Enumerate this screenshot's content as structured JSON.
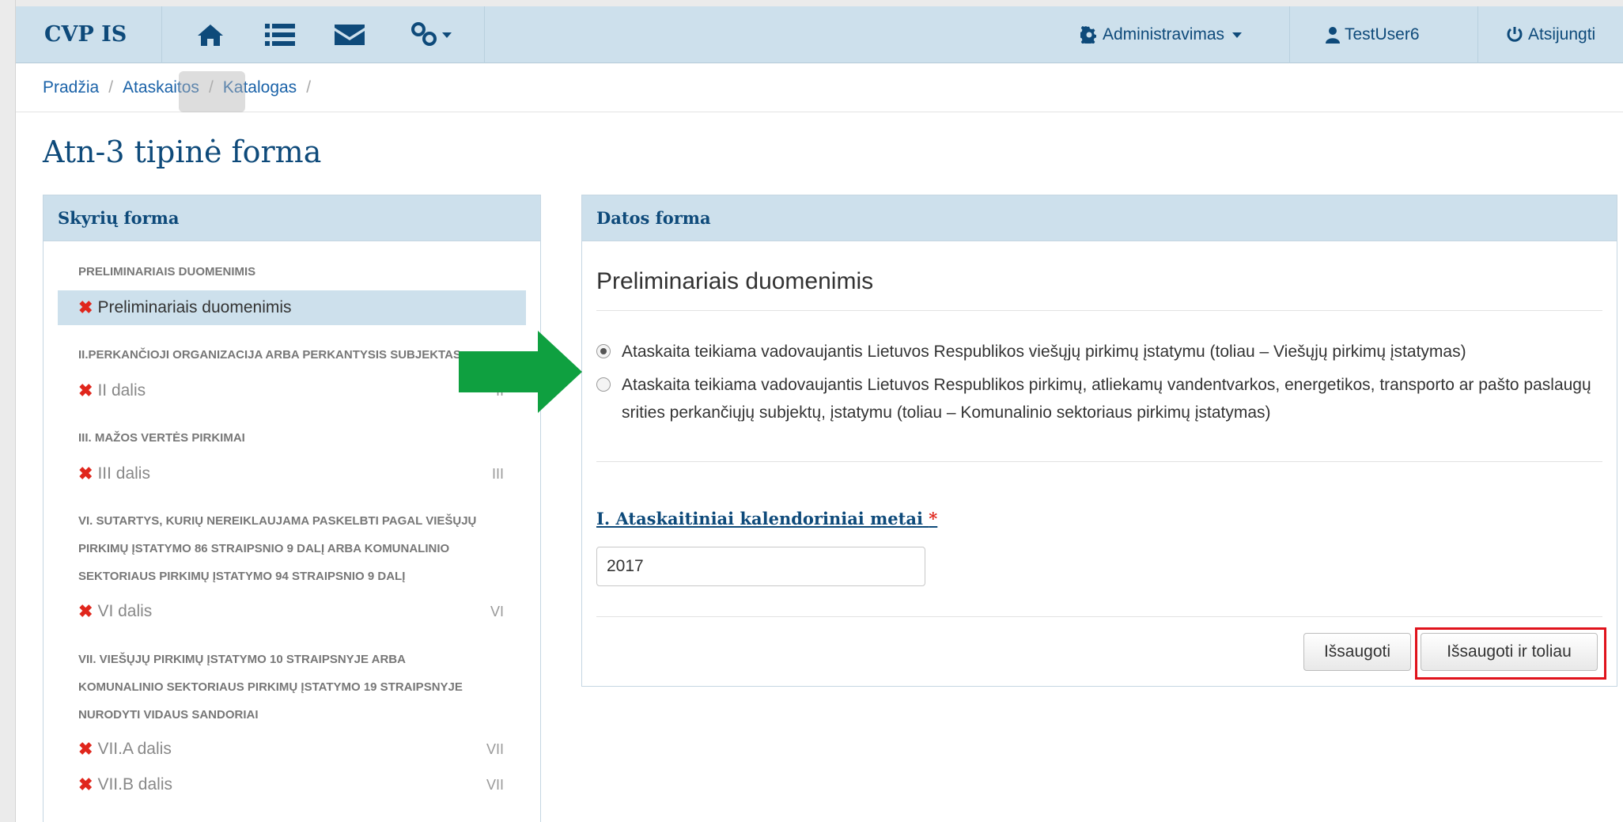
{
  "navbar": {
    "brand": "CVP IS",
    "icons": [
      "home-icon",
      "list-icon",
      "envelope-icon",
      "link-icon"
    ],
    "admin_label": "Administravimas",
    "user_label": "TestUser6",
    "logout_label": "Atsijungti"
  },
  "breadcrumb": {
    "items": [
      "Pradžia",
      "Ataskaitos",
      "Katalogas"
    ]
  },
  "page_title": "Atn-3 tipinė forma",
  "left_panel": {
    "title": "Skyrių forma",
    "sections": [
      {
        "header": "PRELIMINARIAIS DUOMENIMIS",
        "items": [
          {
            "label": "Preliminariais duomenimis",
            "roman": ""
          }
        ]
      },
      {
        "header": "II.PERKANČIOJI ORGANIZACIJA ARBA PERKANTYSIS SUBJEKTAS",
        "items": [
          {
            "label": "II dalis",
            "roman": "II"
          }
        ]
      },
      {
        "header": "III. MAŽOS VERTĖS PIRKIMAI",
        "items": [
          {
            "label": "III dalis",
            "roman": "III"
          }
        ]
      },
      {
        "header_lines": [
          "VI. SUTARTYS, KURIŲ NEREIKLAUJAMA PASKELBTI PAGAL VIEŠŲJŲ",
          "PIRKIMŲ ĮSTATYMO 86 STRAIPSNIO 9 DALĮ ARBA KOMUNALINIO",
          "SEKTORIAUS PIRKIMŲ ĮSTATYMO 94 STRAIPSNIO 9 DALĮ"
        ],
        "items": [
          {
            "label": "VI dalis",
            "roman": "VI"
          }
        ]
      },
      {
        "header_lines": [
          "VII. VIEŠŲJŲ PIRKIMŲ ĮSTATYMO 10 STRAIPSNYJE ARBA",
          "KOMUNALINIO SEKTORIAUS PIRKIMŲ ĮSTATYMO 19 STRAIPSNYJE",
          "NURODYTI VIDAUS SANDORIAI"
        ],
        "items": [
          {
            "label": "VII.A dalis",
            "roman": "VII"
          },
          {
            "label": "VII.B dalis",
            "roman": "VII"
          }
        ]
      }
    ]
  },
  "right_panel": {
    "title": "Datos forma",
    "form_heading": "Preliminariais duomenimis",
    "radio_options": [
      {
        "label": "Ataskaita teikiama vadovaujantis Lietuvos Respublikos viešųjų pirkimų įstatymu (toliau – Viešųjų pirkimų įstatymas)",
        "checked": true
      },
      {
        "label": "Ataskaita teikiama vadovaujantis Lietuvos Respublikos pirkimų, atliekamų vandentvarkos, energetikos, transporto ar pašto paslaugų srities perkančiųjų subjektų, įstatymu (toliau – Komunalinio sektoriaus pirkimų įstatymas)",
        "checked": false
      }
    ],
    "field_label": "I. Ataskaitiniai kalendoriniai metai",
    "required_mark": "*",
    "year_value": "2017",
    "save_label": "Išsaugoti",
    "save_next_label": "Išsaugoti ir toliau"
  },
  "colors": {
    "accent": "#0e4a7a",
    "header_bg": "#cde0ec",
    "error_x": "#e0261c",
    "annotation_arrow": "#0fa040",
    "annotation_box": "#e0131c"
  }
}
